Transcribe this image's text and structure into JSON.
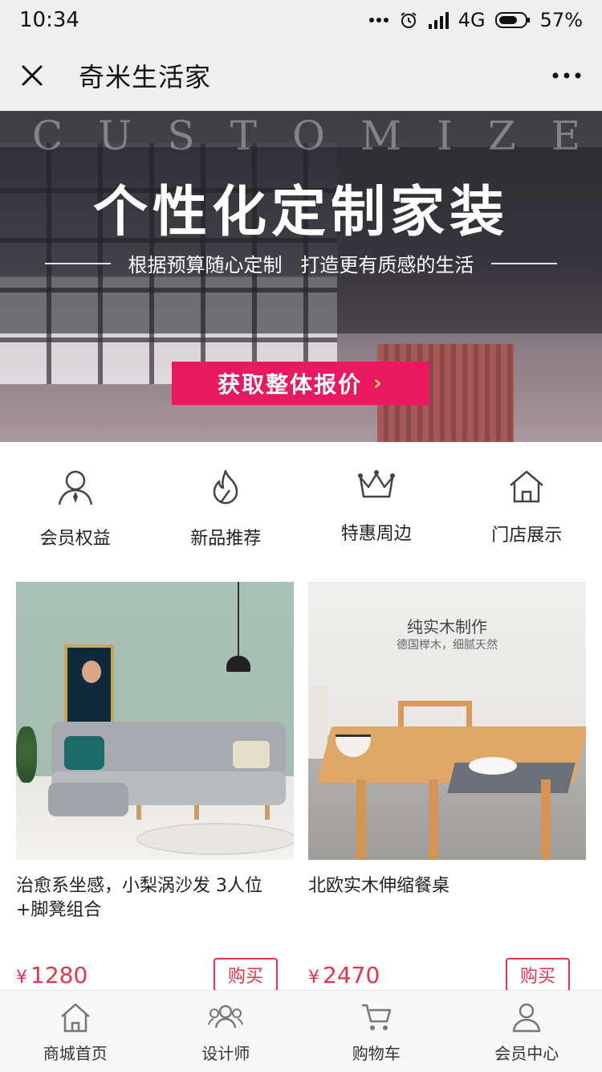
{
  "status_bar": {
    "time": "10:34",
    "network": "4G",
    "battery": "57%"
  },
  "nav": {
    "title": "奇米生活家"
  },
  "banner": {
    "overlay_word": "CUSTOMIZED",
    "headline": "个性化定制家装",
    "subline": "根据预算随心定制   打造更有质感的生活",
    "cta": "获取整体报价",
    "cta_arrow": "›"
  },
  "quick_menu": [
    {
      "label": "会员权益",
      "icon": "member-icon"
    },
    {
      "label": "新品推荐",
      "icon": "fire-icon"
    },
    {
      "label": "特惠周边",
      "icon": "crown-icon"
    },
    {
      "label": "门店展示",
      "icon": "home-icon"
    }
  ],
  "products": [
    {
      "name": "治愈系坐感，小梨涡沙发 3人位+脚凳组合",
      "currency": "¥",
      "price": "1280",
      "buy_label": "购买"
    },
    {
      "name": "北欧实木伸缩餐桌",
      "currency": "¥",
      "price": "2470",
      "buy_label": "购买",
      "image_title": "纯实木制作",
      "image_subtitle": "德国榉木，细腻天然"
    }
  ],
  "tab_bar": [
    {
      "label": "商城首页",
      "icon": "home-icon"
    },
    {
      "label": "设计师",
      "icon": "designers-icon"
    },
    {
      "label": "购物车",
      "icon": "cart-icon"
    },
    {
      "label": "会员中心",
      "icon": "user-icon"
    }
  ],
  "colors": {
    "accent": "#e8334a",
    "cta": "#e8195f",
    "bar_bg": "#efefef"
  }
}
